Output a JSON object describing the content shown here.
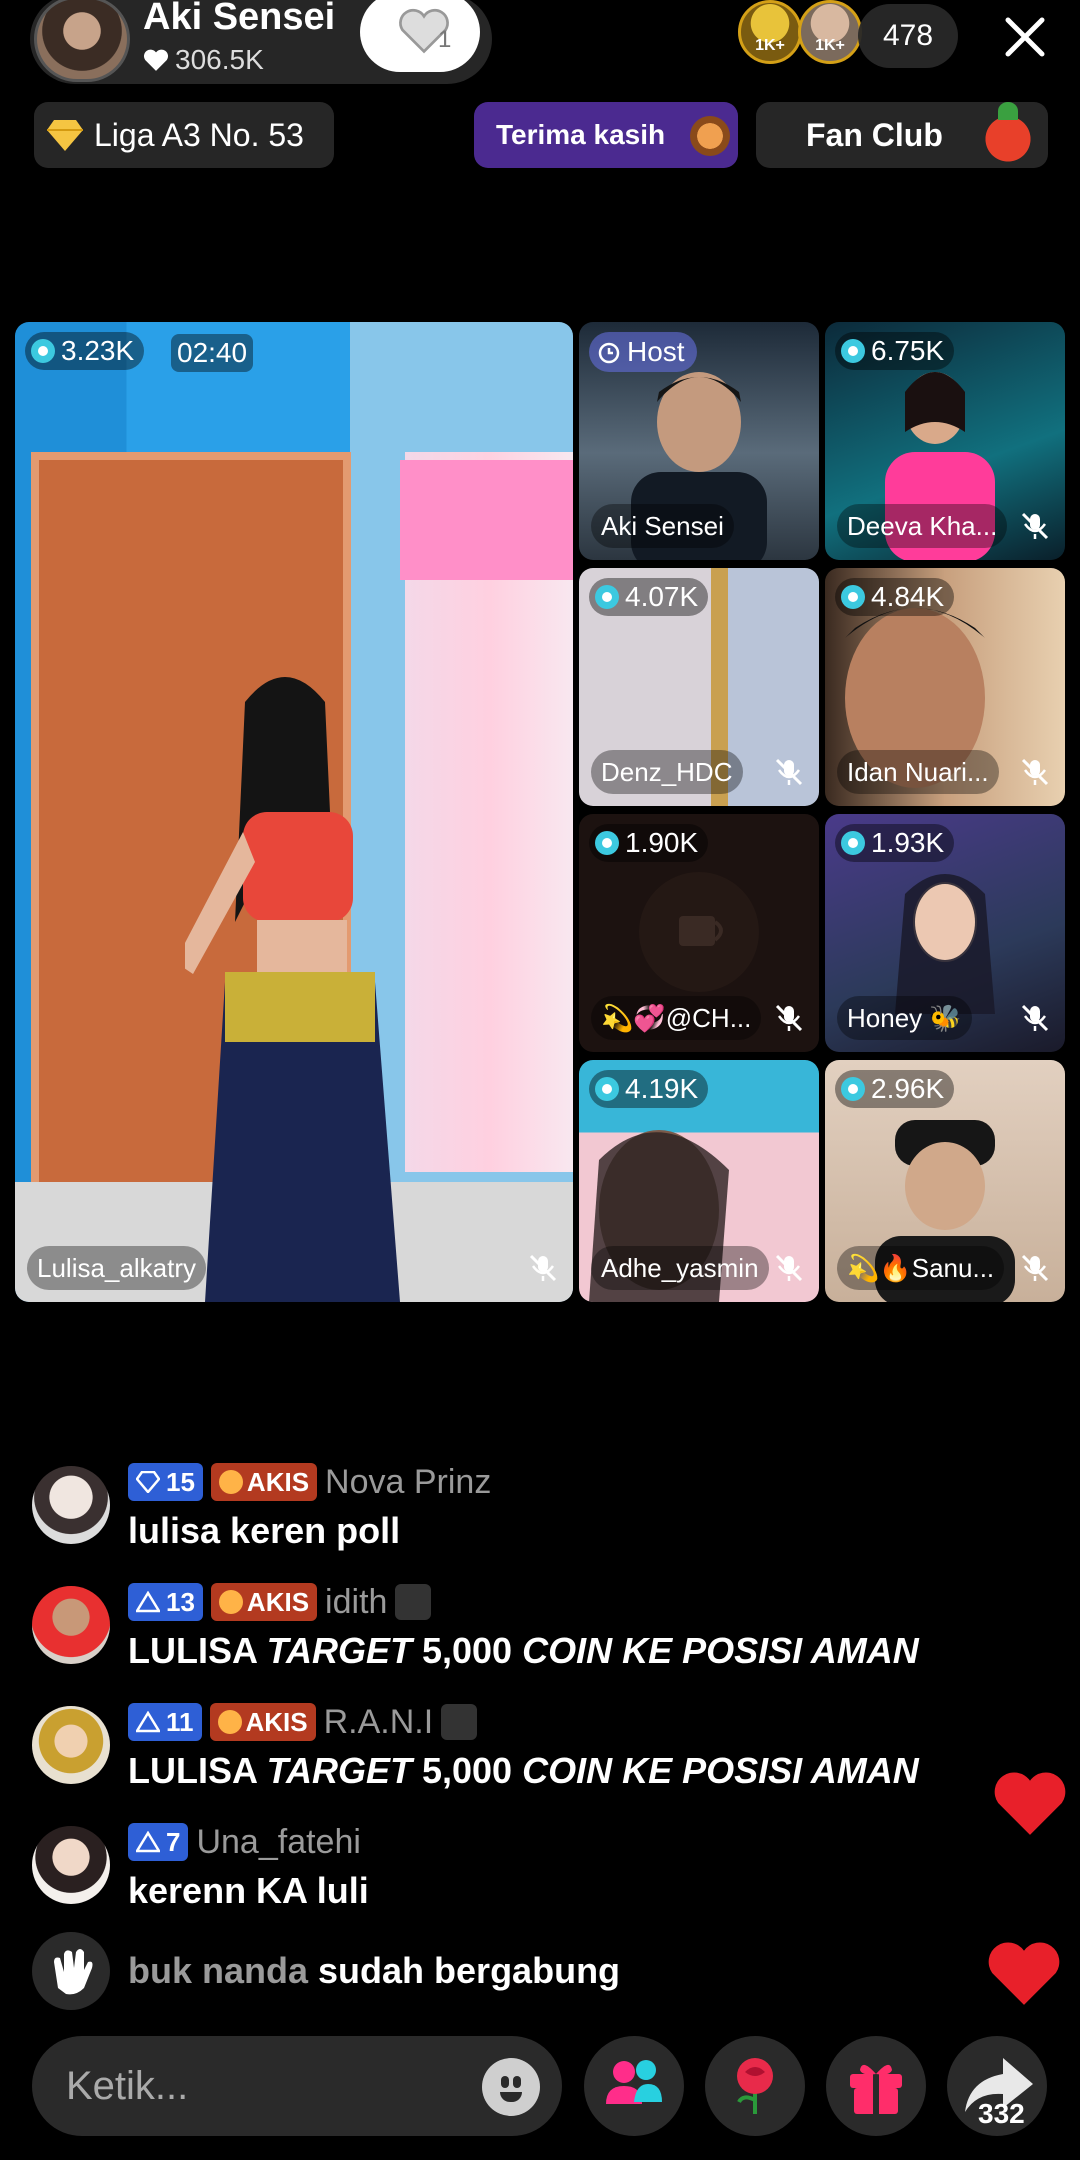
{
  "host": {
    "name": "Aki Sensei",
    "likes": "306.5K",
    "like_count": "1"
  },
  "top": {
    "badge_1": "1K+",
    "badge_2": "1K+",
    "viewers": "478"
  },
  "pills": {
    "league": "Liga A3 No. 53",
    "thanks": "Terima kasih",
    "fan_club": "Fan Club"
  },
  "main_tile": {
    "score": "3.23K",
    "timer": "02:40",
    "name": "Lulisa_alkatry"
  },
  "tiles": [
    {
      "score": "Host",
      "name": "Aki Sensei"
    },
    {
      "score": "6.75K",
      "name": "Deeva Kha..."
    },
    {
      "score": "4.07K",
      "name": "Denz_HDC"
    },
    {
      "score": "4.84K",
      "name": "Idan Nuari..."
    },
    {
      "score": "1.90K",
      "name": "💫💞@CH..."
    },
    {
      "score": "1.93K",
      "name": "Honey 🐝"
    },
    {
      "score": "4.19K",
      "name": "Adhe_yasmin"
    },
    {
      "score": "2.96K",
      "name": "💫🔥Sanu..."
    }
  ],
  "chat": [
    {
      "level": "15",
      "fan": "AKIS",
      "user": "Nova Prinz",
      "msg": "lulisa keren poll"
    },
    {
      "level": "13",
      "fan": "AKIS",
      "user": "idith",
      "msg_a": "LULISA ",
      "msg_b": "TARGET",
      "msg_c": " 5,000 ",
      "msg_d": "COIN KE POSISI AMAN"
    },
    {
      "level": "11",
      "fan": "AKIS",
      "user": "R.A.N.I",
      "msg_a": "LULISA ",
      "msg_b": "TARGET",
      "msg_c": " 5,000 ",
      "msg_d": "COIN KE POSISI AMAN"
    },
    {
      "level": "7",
      "user": "Una_fatehi",
      "msg": "kerenn KA luli"
    }
  ],
  "join": {
    "user": "buk nanda",
    "text": " sudah bergabung"
  },
  "bottom": {
    "placeholder": "Ketik...",
    "share_count": "332"
  },
  "colors": {
    "accent_purple": "#4b2a90",
    "level_blue": "#2e5fd6",
    "fan_red": "#b33a20",
    "heart_red": "#e8202a",
    "stat_cyan": "#3cc9e0"
  }
}
